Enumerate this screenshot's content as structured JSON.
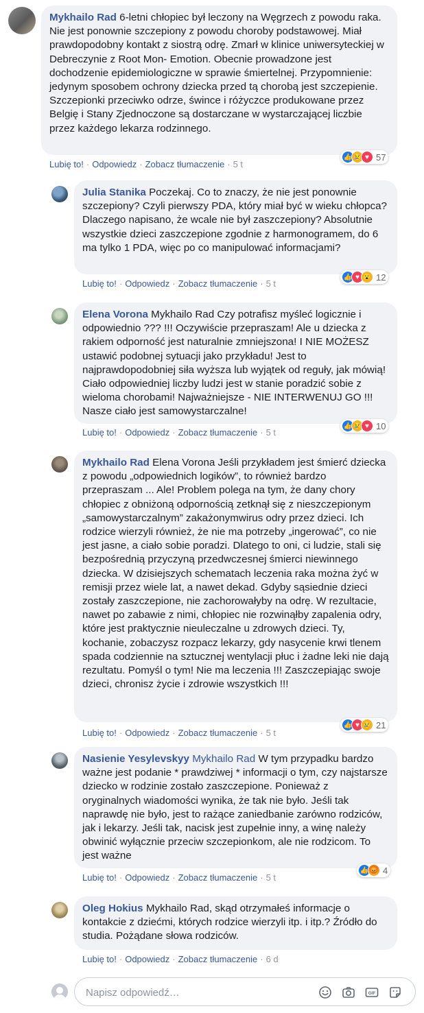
{
  "comments": [
    {
      "author": "Mykhailo Rad",
      "mention": "",
      "text": "6-letni chłopiec był leczony na Węgrzech z powodu raka. Nie jest ponownie szczepiony z powodu choroby podstawowej. Miał prawdopodobny kontakt z siostrą odrę. Zmarł w klinice uniwersyteckiej w Debreczynie z Root Mon- Emotion. Obecnie prowadzone jest dochodzenie epidemiologiczne w sprawie śmiertelnej. Przypomnienie: jedynym sposobem ochrony dziecka przed tą chorobą jest szczepienie. Szczepionki przeciwko odrze, śwince i różyczce produkowane przez Belgię i Stany Zjednoczone są dostarczane w wystarczającej liczbie przez każdego lekarza rodzinnego.",
      "like": "Lubię to!",
      "reply": "Odpowiedz",
      "translate": "Zobacz tłumaczenie",
      "time": "5 t",
      "reactions": [
        "like",
        "sad",
        "love"
      ],
      "reaction_count": "57"
    },
    {
      "author": "Julia Stanika",
      "mention": "",
      "text": "Poczekaj. Co to znaczy, że nie jest ponownie szczepiony? Czyli pierwszy PDA, który miał być w wieku chłopca? Dlaczego napisano, że wcale nie był zaszczepiony? Absolutnie wszystkie dzieci zaszczepione zgodnie z harmonogramem, do 6 ma tylko 1 PDA, więc po co manipulować informacjami?",
      "like": "Lubię to!",
      "reply": "Odpowiedz",
      "translate": "Zobacz tłumaczenie",
      "time": "5 t",
      "reactions": [
        "like",
        "love",
        "wow"
      ],
      "reaction_count": "12"
    },
    {
      "author": "Elena Vorona",
      "mention": "",
      "text": "Mykhailo Rad Czy potrafisz myśleć logicznie i odpowiednio ??? !!! Oczywiście przepraszam! Ale u dziecka z rakiem odporność jest naturalnie zmniejszona! I NIE MOŻESZ ustawić podobnej sytuacji jako przykładu! Jest to najprawdopodobniej siła wyższa lub wyjątek od reguły, jak mówią! Ciało odpowiedniej liczby ludzi jest w stanie poradzić sobie z wieloma chorobami! Najważniejsze - NIE INTERWENUJ GO !!! Nasze ciało jest samowystarczalne!",
      "like": "Lubię to!",
      "reply": "Odpowiedz",
      "translate": "Zobacz tłumaczenie",
      "time": "5 t",
      "reactions": [
        "like",
        "sad",
        "love"
      ],
      "reaction_count": "10"
    },
    {
      "author": "Mykhailo Rad",
      "mention": "",
      "text": "Elena Vorona Jeśli przykładem jest śmierć dziecka z powodu „odpowiednich logików”, to również bardzo przepraszam ... Ale! Problem polega na tym, że dany chory chłopiec z obniżoną odpornością zetknął się z nieszczepionym „samowystarczalnym” zakażonymwirus odry przez dzieci. Ich rodzice wierzyli również, że nie ma potrzeby „ingerować”, co nie jest jasne, a ciało sobie poradzi. Dlatego to oni, ci ludzie, stali się bezpośrednią przyczyną przedwczesnej śmierci niewinnego dziecka. W dzisiejszych schematach leczenia raka można żyć w remisji przez wiele lat, a nawet dekad. Gdyby sąsiednie dzieci zostały zaszczepione, nie zachorowałyby na odrę. W rezultacie, nawet po zabawie z nimi, chłopiec nie rozwinąłby zapalenia odry, które jest praktycznie nieuleczalne u zdrowych dzieci. Ty, kochanie, zobaczysz rozpacz lekarzy, gdy nasycenie krwi tlenem spada codziennie na sztucznej wentylacji płuc i żadne leki nie dają rezultatu. Pomyśl o tym! Nie ma leczenia !!! Zaszczepiając swoje dzieci, chronisz życie i zdrowie wszystkich !!!",
      "like": "Lubię to!",
      "reply": "Odpowiedz",
      "translate": "Zobacz tłumaczenie",
      "time": "5 t",
      "reactions": [
        "like",
        "love",
        "sad"
      ],
      "reaction_count": "21"
    },
    {
      "author": "Nasienie Yesylevskyy",
      "mention": "Mykhailo Rad",
      "text": "W tym przypadku bardzo ważne jest podanie * prawdziwej * informacji o tym, czy najstarsze dziecko w rodzinie zostało zaszczepione. Ponieważ z oryginalnych wiadomości wynika, że tak nie było. Jeśli tak naprawdę nie było, jest to rażące zaniedbanie zarówno rodziców, jak i lekarzy. Jeśli tak, nacisk jest zupełnie inny, a winę należy obwinić wyłącznie przeciw szczepionkom, ale nie rodzicom. To jest ważne",
      "like": "Lubię to!",
      "reply": "Odpowiedz",
      "translate": "Zobacz tłumaczenie",
      "time": "5 t",
      "reactions": [
        "like",
        "angry"
      ],
      "reaction_count": "4"
    },
    {
      "author": "Oleg Hokius",
      "mention": "",
      "text": "Mykhailo Rad, skąd otrzymałeś informacje o kontakcie z dziećmi, których rodzice wierzyli itp. i itp.? Źródło do studia. Pożądane słowa rodziców.",
      "like": "Lubię to!",
      "reply": "Odpowiedz",
      "translate": "Zobacz tłumaczenie",
      "time": "6 d",
      "reactions": [],
      "reaction_count": ""
    }
  ],
  "composer": {
    "placeholder": "Napisz odpowiedź…",
    "icons": [
      "emoji-icon",
      "camera-icon",
      "gif-icon",
      "sticker-icon"
    ]
  },
  "colors": {
    "link": "#385898",
    "bubble": "#f0f2f5",
    "meta": "#90949c"
  }
}
